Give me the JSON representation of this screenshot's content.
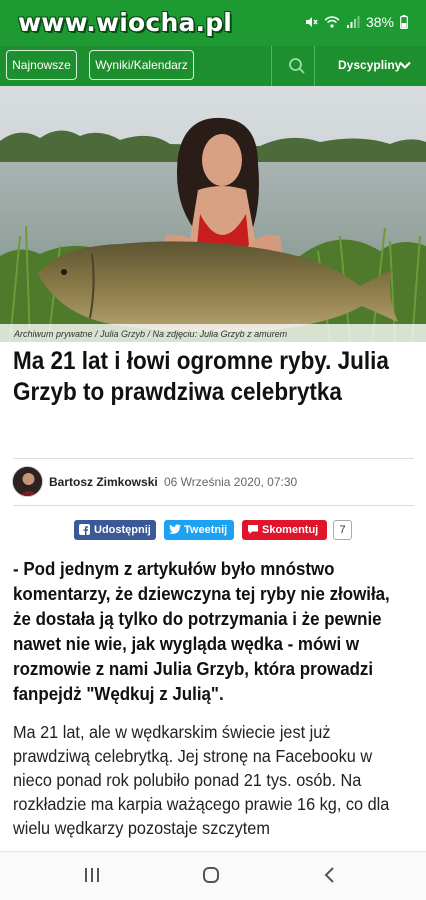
{
  "status_bar": {
    "watermark": "www.wiocha.pl",
    "battery": "38%",
    "icons": [
      "mute-icon",
      "wifi-icon",
      "signal-icon",
      "battery-icon"
    ]
  },
  "nav": {
    "newest_label": "Najnowsze",
    "results_label": "Wyniki/Kalendarz",
    "disciplines_label": "Dyscypliny",
    "icons": [
      "search-icon",
      "chevron-down-icon"
    ]
  },
  "hero": {
    "caption": "Archiwum prywatne / Julia Grzyb / Na zdjęciu: Julia Grzyb z amurem"
  },
  "article": {
    "headline": "Ma 21 lat i łowi ogromne ryby. Julia Grzyb to prawdziwa celebrytka",
    "author": "Bartosz Zimkowski",
    "date": "06 Września 2020, 07:30",
    "share": {
      "facebook": "Udostępnij",
      "twitter": "Tweetnij",
      "comments": "Skomentuj",
      "comment_count": "7"
    },
    "lead": "- Pod jednym z artykułów było mnóstwo komentarzy, że dziewczyna tej ryby nie złowiła, że dostała ją tylko do potrzymania i że pewnie nawet nie wie, jak wygląda wędka - mówi w rozmowie z nami Julia Grzyb, która prowadzi fanpejdż \"Wędkuj z Julią\".",
    "body": "Ma 21 lat, ale w wędkarskim świecie jest już prawdziwą celebrytką. Jej stronę na Facebooku w nieco ponad rok polubiło ponad 21 tys. osób. Na rozkładzie ma karpia ważącego prawie 16 kg, co dla wielu wędkarzy pozostaje szczytem"
  },
  "colors": {
    "brand_green": "#1e8f2f",
    "facebook": "#3b5998",
    "twitter": "#1da1f2",
    "comments": "#e0142a"
  },
  "android_nav": {
    "icons": [
      "recent-apps-icon",
      "home-icon",
      "back-icon"
    ]
  }
}
